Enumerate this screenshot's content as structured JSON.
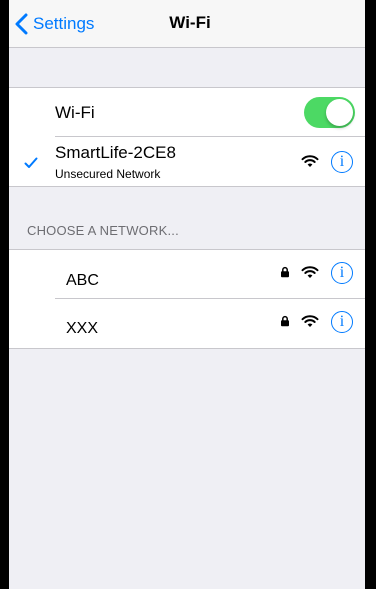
{
  "navbar": {
    "back_label": "Settings",
    "title": "Wi-Fi"
  },
  "wifi_toggle": {
    "label": "Wi-Fi",
    "on": true
  },
  "connected": {
    "name": "SmartLife-2CE8",
    "subtitle": "Unsecured Network",
    "icon": "wifi-icon"
  },
  "choose_header": "CHOOSE A NETWORK...",
  "networks": [
    {
      "name": "ABC",
      "secured": true
    },
    {
      "name": "XXX",
      "secured": true
    }
  ],
  "colors": {
    "accent": "#007aff",
    "toggle_on": "#4cd964",
    "background": "#efeff4"
  }
}
